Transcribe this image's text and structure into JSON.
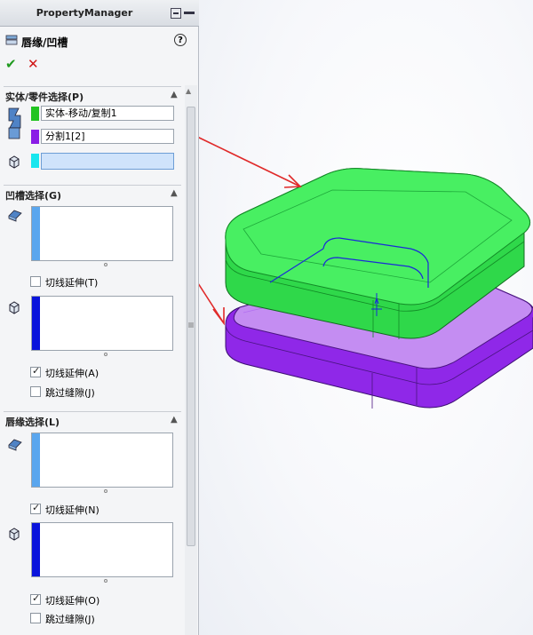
{
  "header": {
    "title": "PropertyManager"
  },
  "feature": {
    "title": "唇缘/凹槽"
  },
  "sections": {
    "body_selection": {
      "title": "实体/零件选择(P)",
      "items": [
        {
          "label": "实体-移动/复制1",
          "color": "#22c422"
        },
        {
          "label": "分割1[2]",
          "color": "#8a1de6"
        }
      ],
      "third_color": "#19e6ee"
    },
    "groove": {
      "title": "凹槽选择(G)",
      "checkboxes": [
        {
          "label": "切线延伸(T)",
          "checked": false
        },
        {
          "label": "切线延伸(A)",
          "checked": true
        },
        {
          "label": "跳过缝隙(J)",
          "checked": false
        }
      ]
    },
    "lip": {
      "title": "唇缘选择(L)",
      "checkboxes": [
        {
          "label": "切线延伸(N)",
          "checked": true
        },
        {
          "label": "切线延伸(O)",
          "checked": true
        },
        {
          "label": "跳过缝隙(J)",
          "checked": false
        }
      ]
    }
  },
  "colors": {
    "face_stripe": "#5aa6ee",
    "edge_stripe": "#0a14dc",
    "green_part": "#2fe34a",
    "purple_part": "#9a2cf0",
    "arrow": "#e02a2a"
  }
}
